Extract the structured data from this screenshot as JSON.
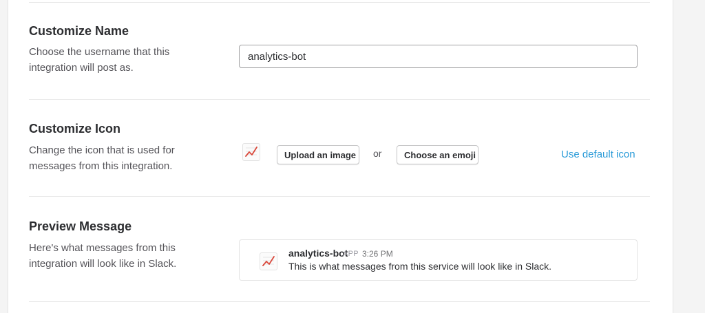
{
  "customize_name": {
    "title": "Customize Name",
    "description": "Choose the username that this integration will post as.",
    "username_value": "analytics-bot"
  },
  "customize_icon": {
    "title": "Customize Icon",
    "description": "Change the icon that is used for messages from this integration.",
    "current_icon": "chart-increasing-icon",
    "upload_label": "Upload an image",
    "or_label": "or",
    "emoji_label": "Choose an emoji",
    "default_label": "Use default icon"
  },
  "preview": {
    "title": "Preview Message",
    "description": "Here's what messages from this integration will look like in Slack.",
    "username": "analytics-bot",
    "badge": "APP",
    "time": "3:26 PM",
    "message": "This is what messages from this service will look like in Slack."
  },
  "colors": {
    "link": "#2a9bd8",
    "chart_line": "#d9473a"
  }
}
